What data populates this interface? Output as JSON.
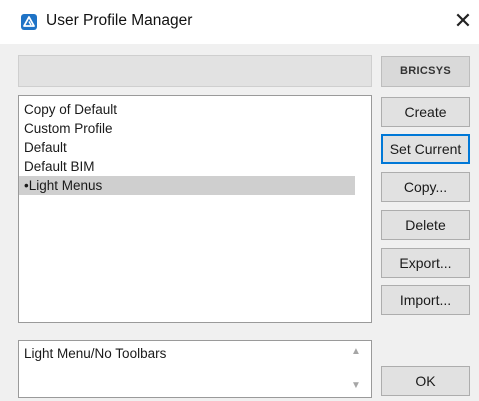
{
  "window": {
    "title": "User Profile Manager",
    "close_glyph": "✕"
  },
  "brand": {
    "logo_text": "BRICSYS"
  },
  "profiles": [
    {
      "label": "Copy of Default"
    },
    {
      "label": "Custom Profile"
    },
    {
      "label": "Default"
    },
    {
      "label": "Default BIM"
    },
    {
      "label": "Light Menus",
      "selected": true
    }
  ],
  "selected_marker": "•",
  "description": {
    "text": "Light Menu/No Toolbars"
  },
  "buttons": {
    "create": "Create",
    "set_current": "Set Current",
    "copy": "Copy...",
    "delete": "Delete",
    "export": "Export...",
    "import": "Import...",
    "ok": "OK"
  },
  "icons": {
    "app": "bricscad-app-icon",
    "scroll_up": "chevron-up-icon",
    "scroll_down": "chevron-down-icon"
  },
  "colors": {
    "app_icon": "#1f73c6",
    "selection": "#cfcfcf",
    "focus_border": "#0078d7"
  }
}
